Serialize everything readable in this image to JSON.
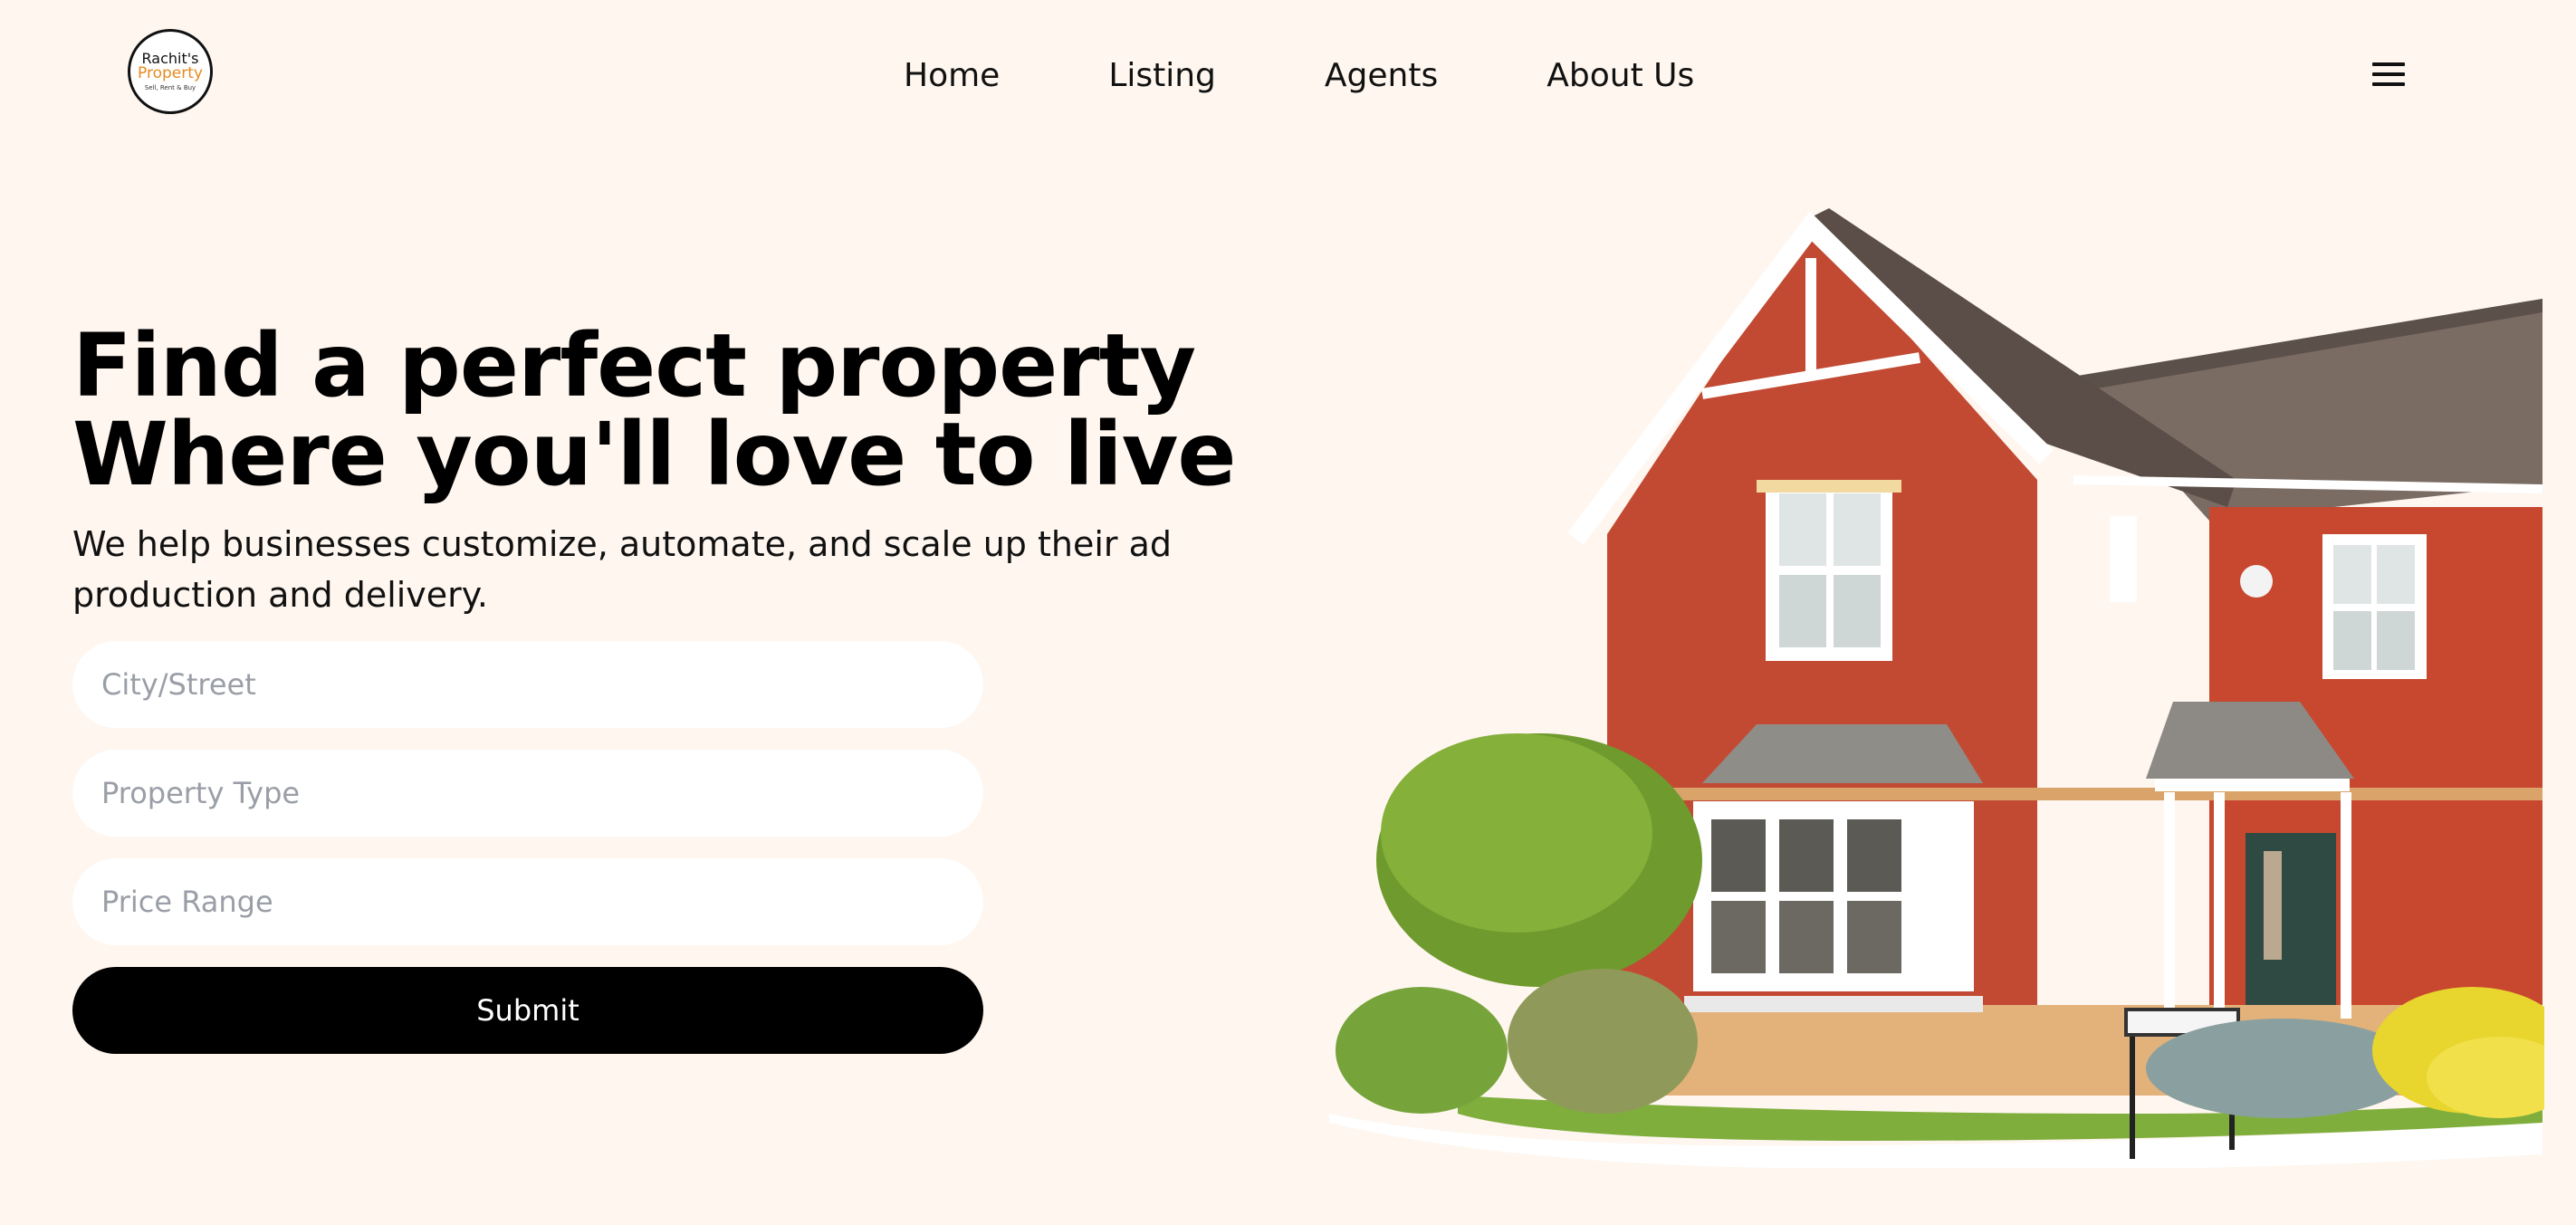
{
  "logo": {
    "line1": "Rachit's",
    "line2": "Property",
    "line3": "Sell, Rent & Buy"
  },
  "nav": {
    "items": [
      {
        "label": "Home"
      },
      {
        "label": "Listing"
      },
      {
        "label": "Agents"
      },
      {
        "label": "About Us"
      }
    ]
  },
  "menu_icon": "hamburger-menu-icon",
  "hero": {
    "title_line1": "Find a perfect property",
    "title_line2": "Where you'll love to live",
    "subtitle": "We help businesses customize, automate, and scale up their ad production and delivery."
  },
  "form": {
    "city_placeholder": "City/Street",
    "type_placeholder": "Property Type",
    "price_placeholder": "Price Range",
    "submit_label": "Submit"
  },
  "colors": {
    "background": "#fef6ef",
    "logo_accent": "#e68a1e",
    "button": "#000000"
  }
}
